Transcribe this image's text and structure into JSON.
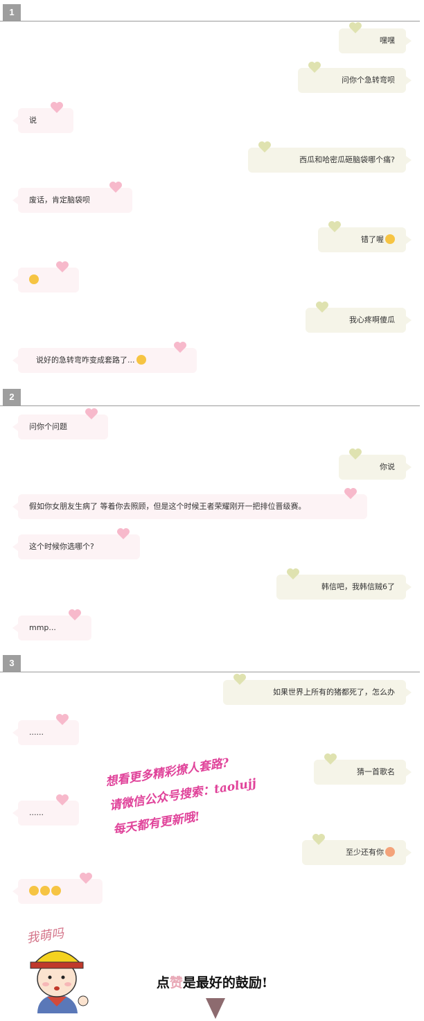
{
  "sections": [
    {
      "number": "1",
      "messages": [
        {
          "side": "right",
          "text": "嘿嘿"
        },
        {
          "side": "right",
          "text": "问你个急转弯呗"
        },
        {
          "side": "left",
          "text": "说"
        },
        {
          "side": "right",
          "text": "西瓜和哈密瓜砸脑袋哪个痛?"
        },
        {
          "side": "left",
          "text": "废话，肯定脑袋呗"
        },
        {
          "side": "right",
          "text": "错了喔",
          "emoji": "flushed-emoji"
        },
        {
          "side": "left",
          "text": "",
          "emoji": "flushed-emoji"
        },
        {
          "side": "right",
          "text": "我心疼啊傻瓜"
        },
        {
          "side": "left",
          "text": "说好的急转弯咋变成套路了...",
          "emoji": "facepalm-emoji"
        }
      ]
    },
    {
      "number": "2",
      "messages": [
        {
          "side": "left",
          "text": "问你个问题"
        },
        {
          "side": "right",
          "text": "你说"
        },
        {
          "side": "left",
          "text": "假如你女朋友生病了 等着你去照顾，但是这个时候王者荣耀刚开一把排位晋级赛。"
        },
        {
          "side": "left",
          "text": "这个时候你选哪个?"
        },
        {
          "side": "right",
          "text": "韩信吧，我韩信贼6了"
        },
        {
          "side": "left",
          "text": "mmp..."
        }
      ]
    },
    {
      "number": "3",
      "messages": [
        {
          "side": "right",
          "text": "如果世界上所有的猪都死了，怎么办"
        },
        {
          "side": "left",
          "text": "......"
        },
        {
          "side": "right",
          "text": "猜一首歌名"
        },
        {
          "side": "left",
          "text": "......"
        },
        {
          "side": "right",
          "text": "至少还有你",
          "emoji": "pig-emoji"
        },
        {
          "side": "left",
          "text": "",
          "emoji": "facepalm-emoji-x3"
        }
      ]
    }
  ],
  "promo": {
    "line1": "想看更多精彩撩人套路?",
    "line2": "请微信公众号搜索：taolujj",
    "line3": "每天都有更新哦!"
  },
  "footer": {
    "mascot_label": "我萌吗",
    "cta_prefix": "点",
    "cta_highlight": "赞",
    "cta_suffix": "是最好的鼓励!"
  },
  "colors": {
    "left_bubble": "#fdf3f5",
    "right_bubble": "#f5f4e8",
    "left_heart": "#f7b9cb",
    "right_heart": "#dfe2b0",
    "promo_text": "#e0439a"
  }
}
